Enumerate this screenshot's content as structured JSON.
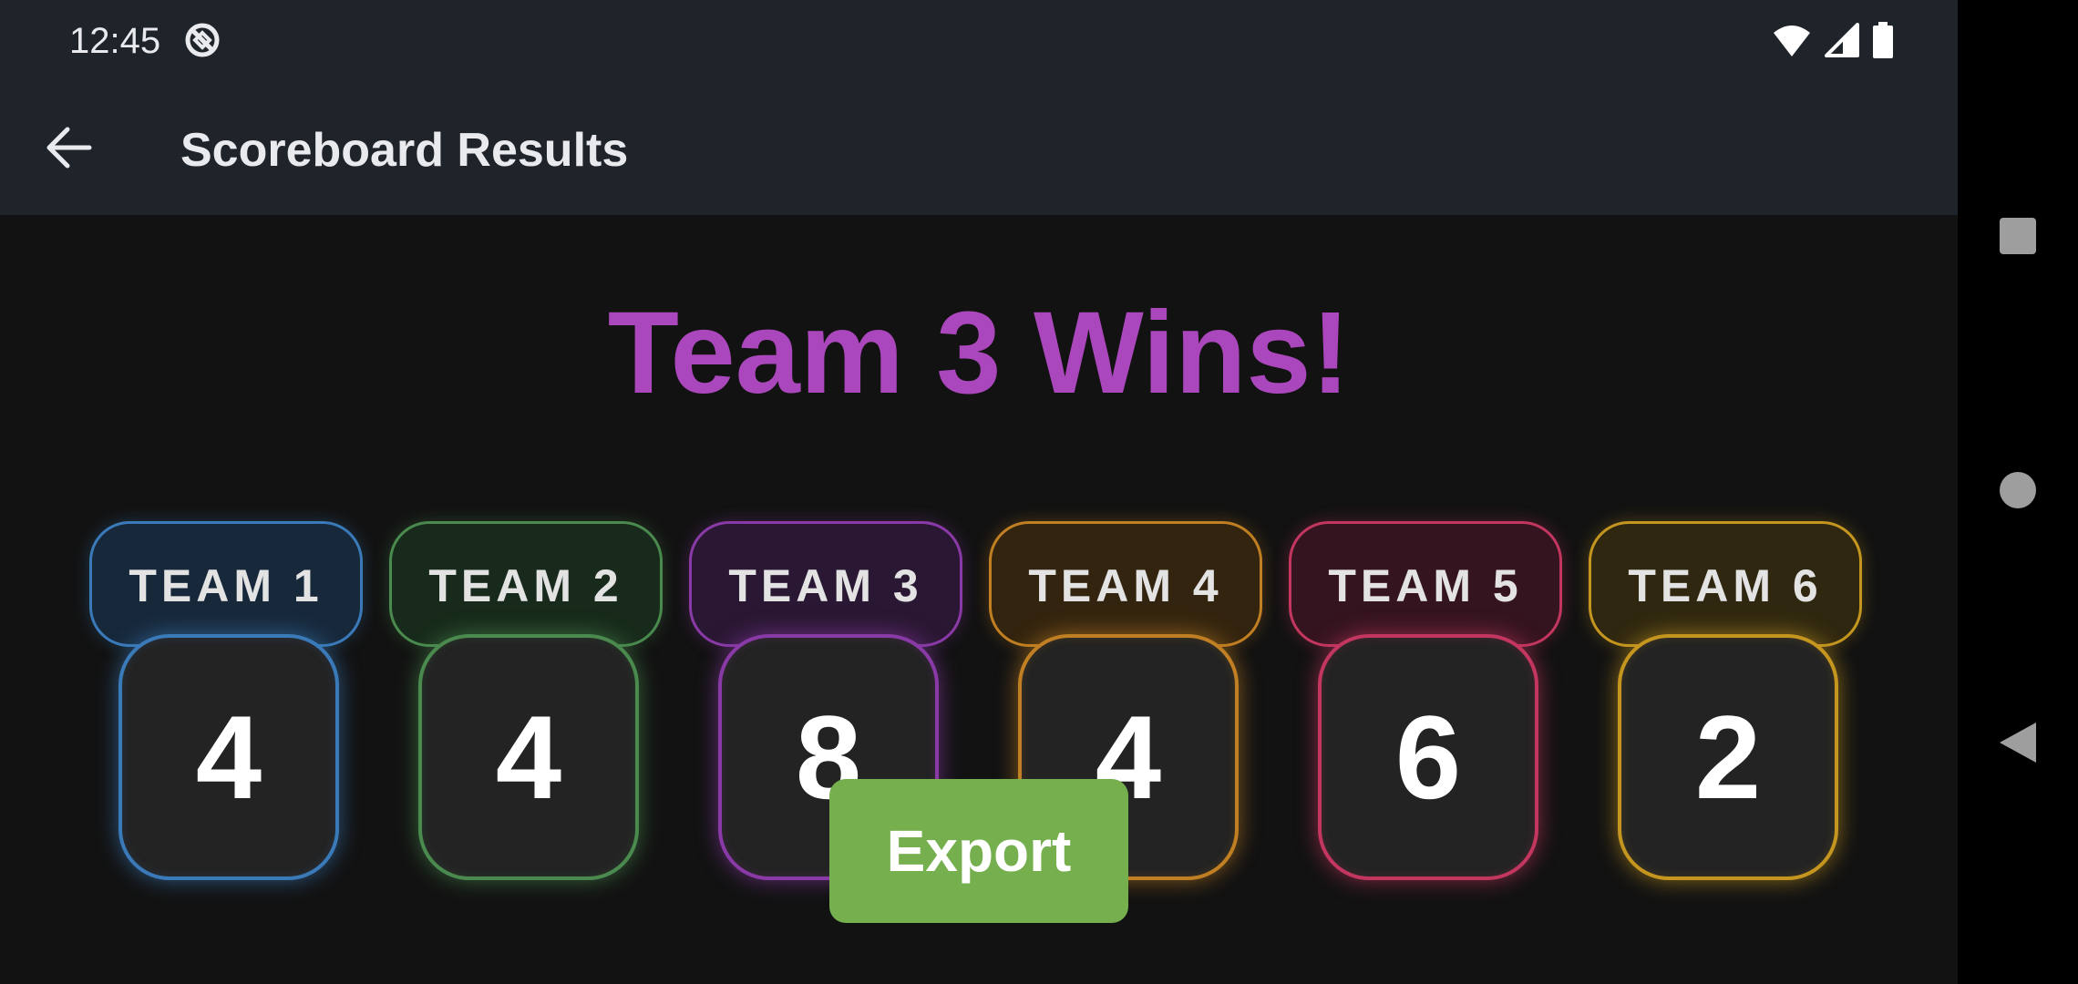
{
  "status_bar": {
    "time": "12:45",
    "icons": [
      "app-notification-icon",
      "wifi-icon",
      "cell-signal-icon",
      "battery-icon"
    ]
  },
  "app_bar": {
    "title": "Scoreboard Results",
    "back_icon": "arrow-back-icon"
  },
  "winner": {
    "text": "Team 3 Wins!",
    "color": "#ab47bc"
  },
  "teams": [
    {
      "label": "TEAM 1",
      "score": "4",
      "color": "#3a7ab8",
      "tint": "#17283a"
    },
    {
      "label": "TEAM 2",
      "score": "4",
      "color": "#4a8a4e",
      "tint": "#182a1b"
    },
    {
      "label": "TEAM 3",
      "score": "8",
      "color": "#8a3aa6",
      "tint": "#2a1733"
    },
    {
      "label": "TEAM 4",
      "score": "4",
      "color": "#c07f22",
      "tint": "#33240f"
    },
    {
      "label": "TEAM 5",
      "score": "6",
      "color": "#c2365f",
      "tint": "#34141f"
    },
    {
      "label": "TEAM 6",
      "score": "2",
      "color": "#c4961f",
      "tint": "#2f2710"
    }
  ],
  "export_button": {
    "label": "Export",
    "color": "#76af4e"
  },
  "nav_bar": {
    "icons": [
      "recents-square-icon",
      "home-circle-icon",
      "back-triangle-icon"
    ]
  }
}
